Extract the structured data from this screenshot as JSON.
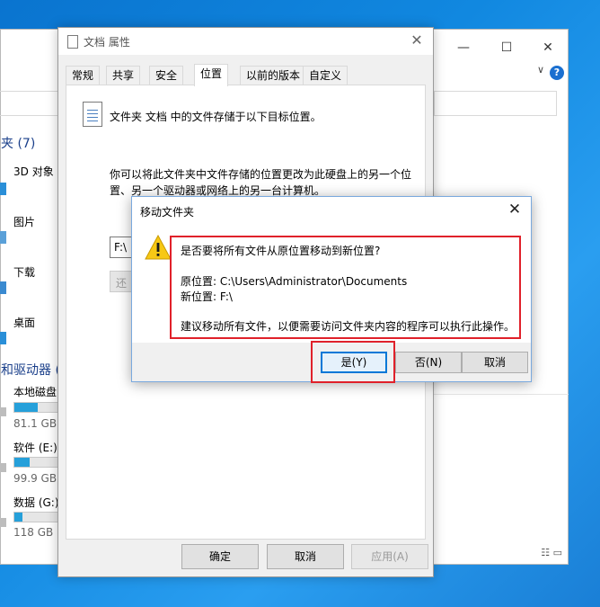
{
  "explorer": {
    "caption_minimize": "—",
    "caption_maximize": "☐",
    "caption_close": "✕",
    "chevron": "∨",
    "help": "?",
    "nav": {
      "folders_heading": "夹 (7)",
      "folders": [
        "3D 对象",
        "图片",
        "下载",
        "桌面"
      ],
      "drives_heading": "和驱动器 (",
      "drives": [
        {
          "label": "本地磁盘",
          "free": "81.1 GB",
          "fill": 0.55
        },
        {
          "label": "软件 (E:)",
          "free": "99.9 GB",
          "fill": 0.35
        },
        {
          "label": "数据 (G:)",
          "free": "118 GB",
          "fill": 0.18
        }
      ]
    },
    "view_icons": "☷ ▭"
  },
  "props": {
    "title": "文档 属性",
    "close": "✕",
    "tabs": [
      "常规",
      "共享",
      "安全",
      "位置",
      "以前的版本",
      "自定义"
    ],
    "active_tab": "位置",
    "line1": "文件夹 文档 中的文件存储于以下目标位置。",
    "desc": "你可以将此文件夹中文件存储的位置更改为此硬盘上的另一个位置、另一个驱动器或网络上的另一台计算机。",
    "location_value": "F:\\",
    "restore_label": "还",
    "ok_label": "确定",
    "cancel_label": "取消",
    "apply_label": "应用(A)"
  },
  "move": {
    "title": "移动文件夹",
    "close": "✕",
    "question": "是否要将所有文件从原位置移动到新位置?",
    "old_location": "原位置: C:\\Users\\Administrator\\Documents",
    "new_location": "新位置: F:\\",
    "advice": "建议移动所有文件，以便需要访问文件夹内容的程序可以执行此操作。",
    "yes_label": "是(Y)",
    "no_label": "否(N)",
    "cancel_label": "取消",
    "highlight_color": "#e0212a",
    "warning_color": "#f7c815"
  }
}
